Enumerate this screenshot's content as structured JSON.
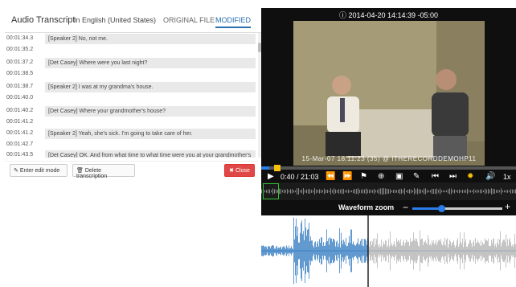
{
  "header": {
    "title": "Audio Transcript",
    "language": "In English (United States)",
    "tab_original": "ORIGINAL FILE",
    "tab_modified": "MODIFIED"
  },
  "transcript": [
    {
      "start": "00:01:34.3",
      "end": "00:01:35.2",
      "text": "[Speaker 2] No, not me."
    },
    {
      "start": "00:01:37.2",
      "end": "00:01:38.5",
      "text": "[Det Casey] Where were you last night?"
    },
    {
      "start": "00:01:38.7",
      "end": "00:01:40.0",
      "text": "[Speaker 2] I was at my grandma's house."
    },
    {
      "start": "00:01:40.2",
      "end": "00:01:41.2",
      "text": "[Det Casey] Where your grandmother's house?"
    },
    {
      "start": "00:01:41.2",
      "end": "00:01:42.7",
      "text": "[Speaker 2] Yeah, she's sick. I'm going to take care of her."
    },
    {
      "start": "00:01:43.5",
      "end": "",
      "text": "[Det Casey] OK. And from what time to what time were you at your grandmother's"
    }
  ],
  "buttons": {
    "edit": "Enter edit mode",
    "delete": "Delete transcription",
    "close": "Close"
  },
  "player": {
    "timestamp": "2014-04-20 14:14:39 -05:00",
    "video_caption": "15-Mar-07  18:11:23 (35) @ ITHERECORDDEMOHP11",
    "current_time": "0:40 / 21:03",
    "speed": "1x",
    "progress_fraction": 0.03,
    "zoom_label": "Waveform zoom",
    "zoom_fraction": 0.32
  },
  "colors": {
    "accent": "#2b7de9",
    "close_red": "#e04848",
    "knob_yellow": "#f4c20d",
    "overview_green": "#2fbf2f"
  },
  "icons": [
    "info-icon",
    "play-icon",
    "rewind-icon",
    "fast-forward-icon",
    "bookmark-icon",
    "zoom-icon",
    "picture-icon",
    "wrench-icon",
    "skip-back-icon",
    "skip-forward-icon",
    "waveform-icon",
    "volume-icon",
    "pencil-icon",
    "trash-icon",
    "close-icon"
  ]
}
